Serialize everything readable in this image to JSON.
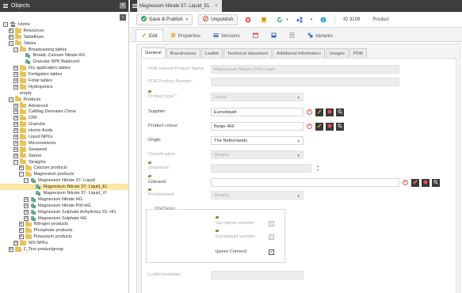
{
  "left": {
    "title": "Objects",
    "close_icon": "×",
    "collapse_icon": "«",
    "tree": [
      {
        "label": "Home",
        "level": 0,
        "toggle": "minus",
        "icon": "home"
      },
      {
        "label": "Resources",
        "level": 1,
        "toggle": "plus",
        "icon": "folder"
      },
      {
        "label": "Tableflows",
        "level": 1,
        "toggle": "plus",
        "icon": "folder"
      },
      {
        "label": "Tables",
        "level": 1,
        "toggle": "minus",
        "icon": "folder"
      },
      {
        "label": "Broadcasting tables",
        "level": 2,
        "toggle": "minus",
        "icon": "folder"
      },
      {
        "label": "Broadc Calcium Nitrate AG",
        "level": 3,
        "toggle": "none",
        "icon": "object"
      },
      {
        "label": "Granular NPK Balanced",
        "level": 3,
        "toggle": "none",
        "icon": "object"
      },
      {
        "label": "Dry application tables",
        "level": 2,
        "toggle": "plus",
        "icon": "folder"
      },
      {
        "label": "Fertigation tables",
        "level": 2,
        "toggle": "plus",
        "icon": "folder"
      },
      {
        "label": "Foliar tables",
        "level": 2,
        "toggle": "plus",
        "icon": "folder"
      },
      {
        "label": "Hydroponics",
        "level": 2,
        "toggle": "plus",
        "icon": "folder"
      },
      {
        "label": "empty",
        "level": 2,
        "toggle": "none",
        "icon": "none"
      },
      {
        "label": "Products",
        "level": 1,
        "toggle": "minus",
        "icon": "folder"
      },
      {
        "label": "Advanced",
        "level": 2,
        "toggle": "plus",
        "icon": "folder"
      },
      {
        "label": "CalMag Derivates China",
        "level": 2,
        "toggle": "plus",
        "icon": "folder"
      },
      {
        "label": "CRF",
        "level": 2,
        "toggle": "plus",
        "icon": "folder"
      },
      {
        "label": "Granular",
        "level": 2,
        "toggle": "plus",
        "icon": "folder"
      },
      {
        "label": "Humic Acids",
        "level": 2,
        "toggle": "plus",
        "icon": "folder"
      },
      {
        "label": "Liquid NPKs",
        "level": 2,
        "toggle": "plus",
        "icon": "folder"
      },
      {
        "label": "Micronutrients",
        "level": 2,
        "toggle": "plus",
        "icon": "folder"
      },
      {
        "label": "Seaweed",
        "level": 2,
        "toggle": "plus",
        "icon": "folder"
      },
      {
        "label": "Starter",
        "level": 2,
        "toggle": "plus",
        "icon": "folder"
      },
      {
        "label": "Straights",
        "level": 2,
        "toggle": "minus",
        "icon": "folder"
      },
      {
        "label": "Calcium products",
        "level": 3,
        "toggle": "plus",
        "icon": "folder"
      },
      {
        "label": "Magnesium products",
        "level": 3,
        "toggle": "minus",
        "icon": "folder"
      },
      {
        "label": "Magnesium Nitrate 37- Liquid",
        "level": 4,
        "toggle": "minus",
        "icon": "object"
      },
      {
        "label": "Magnesium Nitrate 37- Liquid_EL",
        "level": 5,
        "toggle": "none",
        "icon": "object",
        "selected": true
      },
      {
        "label": "Magnesium Nitrate 37- Liquid_VI",
        "level": 5,
        "toggle": "none",
        "icon": "object"
      },
      {
        "label": "Magnesium Nitrate HG",
        "level": 4,
        "toggle": "plus",
        "icon": "object"
      },
      {
        "label": "Magnesium Nitrate Prill HG",
        "level": 4,
        "toggle": "plus",
        "icon": "object"
      },
      {
        "label": "Magnesium Sulphate Anhydrous 33- HG",
        "level": 4,
        "toggle": "plus",
        "icon": "object"
      },
      {
        "label": "Magnesium Sulphate HG",
        "level": 4,
        "toggle": "plus",
        "icon": "object"
      },
      {
        "label": "Nitrogen products",
        "level": 3,
        "toggle": "plus",
        "icon": "folder"
      },
      {
        "label": "Phosphate products",
        "level": 3,
        "toggle": "plus",
        "icon": "folder"
      },
      {
        "label": "Potassium products",
        "level": 3,
        "toggle": "plus",
        "icon": "folder"
      },
      {
        "label": "WS NPKs",
        "level": 2,
        "toggle": "plus",
        "icon": "folder"
      },
      {
        "label": "Z_Test productgroup",
        "level": 1,
        "toggle": "plus",
        "icon": "folder"
      }
    ]
  },
  "doc_tab": {
    "title": "Magnesium Nitrate 37- Liquid_EL",
    "close": "×"
  },
  "toolbar": {
    "save_publish": "Save & Publish",
    "unpublish": "Unpublish",
    "id": "ID 3109",
    "class": "Product"
  },
  "subtabs": [
    "Edit",
    "Properties",
    "Versions",
    "",
    "",
    "",
    "Variants"
  ],
  "form_tabs": [
    "General",
    "Brandnames",
    "Leaflet",
    "Technical datasheet",
    "Additional information",
    "Images",
    "PDB"
  ],
  "form": {
    "pdb_internal_product_name_label": "PDB internal Product Name:",
    "pdb_internal_product_name_value": "Magnesium Nitrate 37% Liquid",
    "pdb_product_number_label": "PDB Product Number:",
    "product_type_label": "Product type *:",
    "product_type_value": "Liquid",
    "supplier_label": "Supplier:",
    "supplier_value": "Eurostiquid",
    "product_colour_label": "Product colour:",
    "product_colour_value": "Beige 466",
    "origin_label": "Origin:",
    "origin_value": "The Netherlands",
    "classification_label": "Classification:",
    "classification_value": "(Empty)",
    "sequence_label": "Sequence:",
    "cobrand_label": "Cobrand:",
    "privatebrand_label": "Privatebrand:",
    "privatebrand_value": "(Empty)",
    "interfaces_legend": "Interfaces",
    "van_iperen_website_label": "Van Iperen website:",
    "eurostiquid_website_label": "Eurostiquid website:",
    "iperen_connect_label": "Iperen Connect:",
    "leaflet_template_label": "Leaflet template:"
  }
}
